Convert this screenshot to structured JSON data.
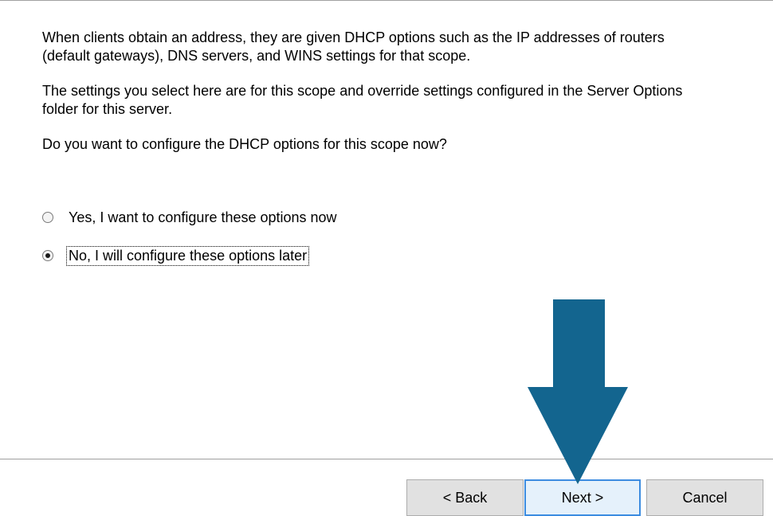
{
  "paragraphs": {
    "p1": "When clients obtain an address, they are given DHCP options such as the IP addresses of routers (default gateways), DNS servers, and WINS settings for that scope.",
    "p2": "The settings you select here are for this scope and override settings configured in the Server Options folder for this server.",
    "p3": "Do you want to configure the DHCP options for this scope now?"
  },
  "options": {
    "yes_label": "Yes, I want to configure these options now",
    "yes_selected": false,
    "no_label": "No, I will configure these options later",
    "no_selected": true
  },
  "buttons": {
    "back": "< Back",
    "next": "Next >",
    "cancel": "Cancel"
  },
  "colors": {
    "arrow": "#13658f",
    "next_border": "#3c8ce0"
  },
  "icons": {
    "arrow": "down-arrow-icon"
  }
}
